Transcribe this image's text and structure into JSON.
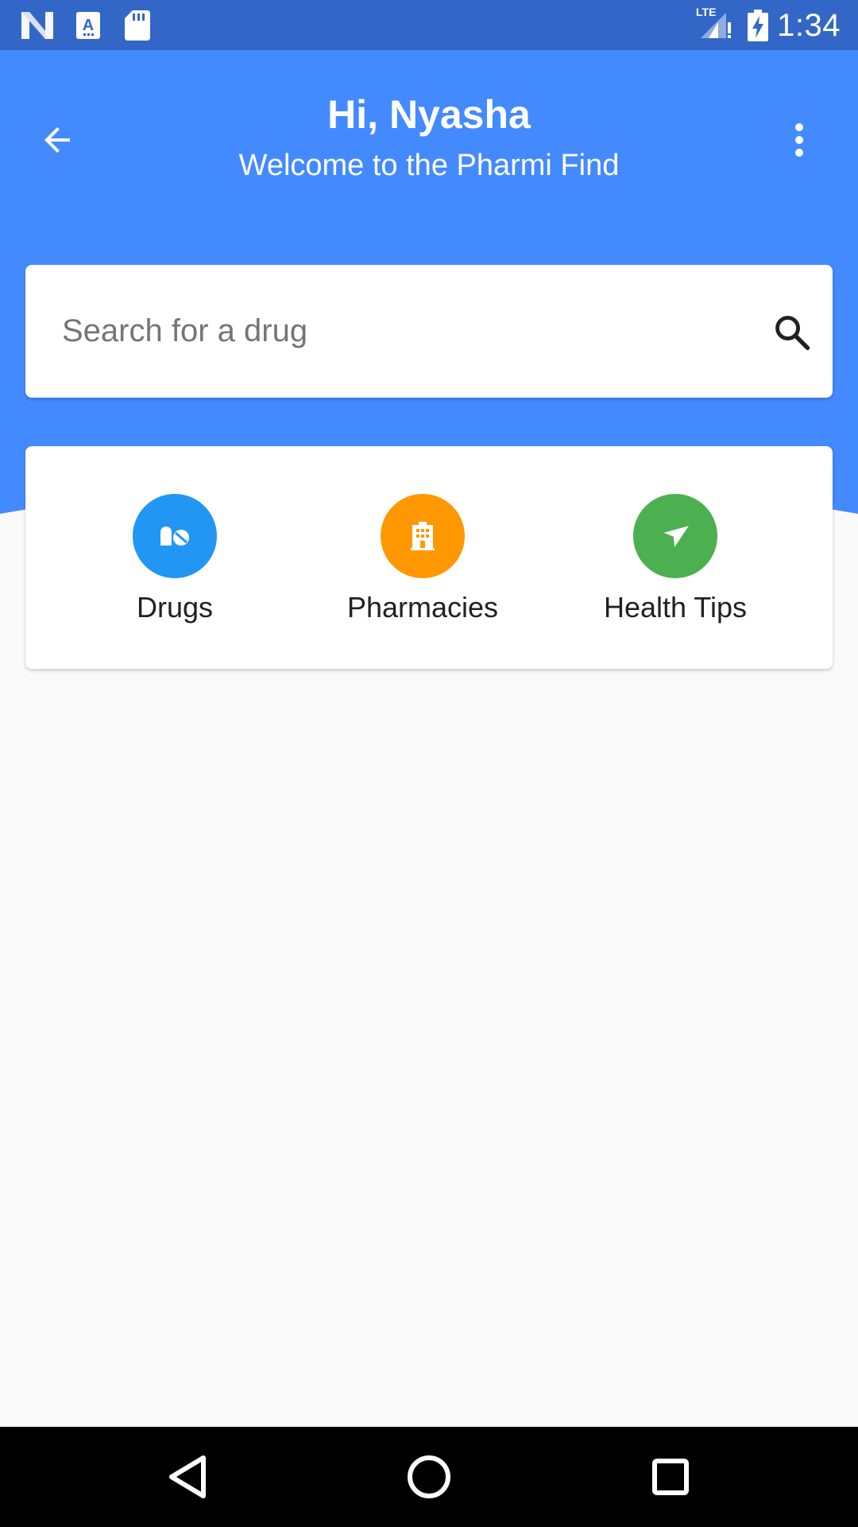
{
  "status_bar": {
    "time": "1:34",
    "network_label": "LTE",
    "left_icons": [
      "n-notification-icon",
      "font-a-icon",
      "sd-card-icon"
    ],
    "right_icons": [
      "signal-lte-icon",
      "battery-charging-icon"
    ]
  },
  "header": {
    "greeting": "Hi, Nyasha",
    "subtitle": "Welcome to the Pharmi Find",
    "back_icon": "arrow-back-icon",
    "menu_icon": "more-vert-icon",
    "background_color": "#448aff"
  },
  "search": {
    "placeholder": "Search for a drug",
    "value": "",
    "icon": "search-icon"
  },
  "categories": [
    {
      "label": "Drugs",
      "icon": "pills-icon",
      "color": "#2196f3"
    },
    {
      "label": "Pharmacies",
      "icon": "building-icon",
      "color": "#ff9800"
    },
    {
      "label": "Health Tips",
      "icon": "navigation-arrow-icon",
      "color": "#4caf50"
    }
  ],
  "nav_bar": {
    "buttons": [
      "back-triangle-icon",
      "home-circle-icon",
      "recents-square-icon"
    ]
  },
  "colors": {
    "status_bar": "#3367c7",
    "primary": "#448aff",
    "background": "#fafafa"
  }
}
